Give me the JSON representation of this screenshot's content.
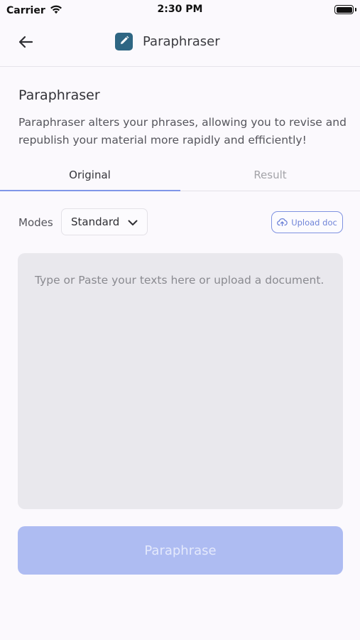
{
  "status_bar": {
    "carrier": "Carrier",
    "time": "2:30 PM"
  },
  "nav": {
    "title": "Paraphraser",
    "back_icon": "arrow-left-icon",
    "logo_icon": "pencil-icon"
  },
  "main": {
    "title": "Paraphraser",
    "description": "Paraphraser alters your phrases, allowing you to revise and republish your material more rapidly and efficiently!"
  },
  "tabs": [
    {
      "label": "Original",
      "active": true
    },
    {
      "label": "Result",
      "active": false
    }
  ],
  "controls": {
    "modes_label": "Modes",
    "mode_value": "Standard",
    "upload_label": "Upload doc"
  },
  "editor": {
    "value": "",
    "placeholder": "Type or Paste your texts here or upload a document."
  },
  "submit": {
    "label": "Paraphrase",
    "enabled": false
  },
  "colors": {
    "accent": "#8096e8",
    "logo_bg": "#2e6683",
    "button_disabled": "#aebcf2",
    "editor_bg": "#e9e8ed"
  }
}
